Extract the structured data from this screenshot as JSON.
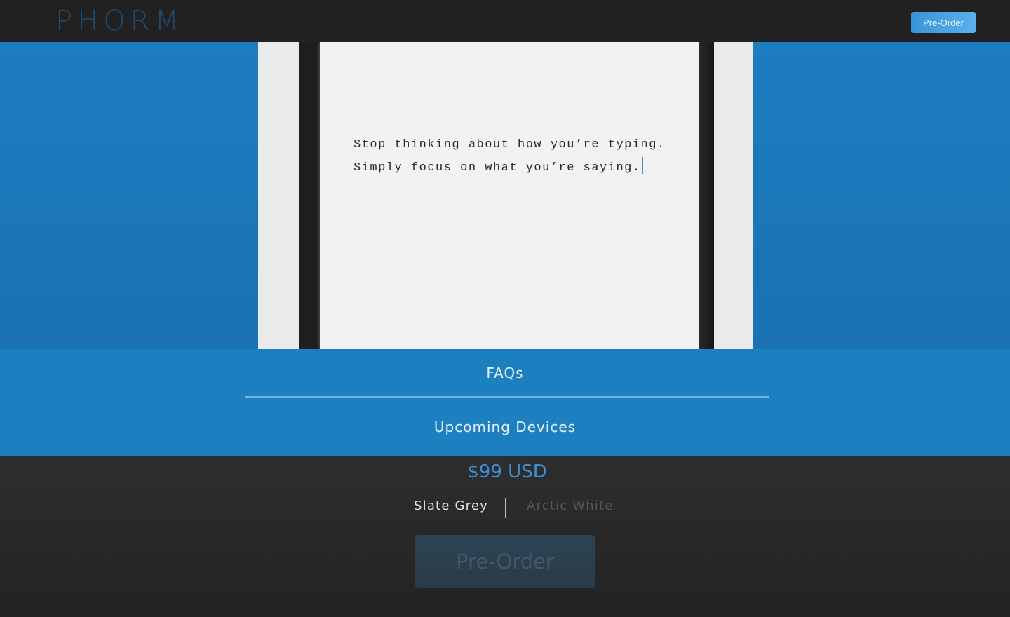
{
  "header": {
    "logo_text": "PHORM",
    "preorder_label": "Pre-Order"
  },
  "hero": {
    "screen_line_1": "Stop thinking about how you’re typing.",
    "screen_line_2": "Simply focus on what you’re saying."
  },
  "links": {
    "faq_label": "FAQs",
    "upcoming_label": "Upcoming Devices"
  },
  "purchase": {
    "price": "$99 USD",
    "colors": [
      "Slate Grey",
      "Arctic White"
    ],
    "selected_color": "Slate Grey",
    "preorder_label": "Pre-Order"
  },
  "theme": {
    "accent": "#1c7fc0",
    "dark": "#212121",
    "price_color": "#3b8fd4"
  }
}
